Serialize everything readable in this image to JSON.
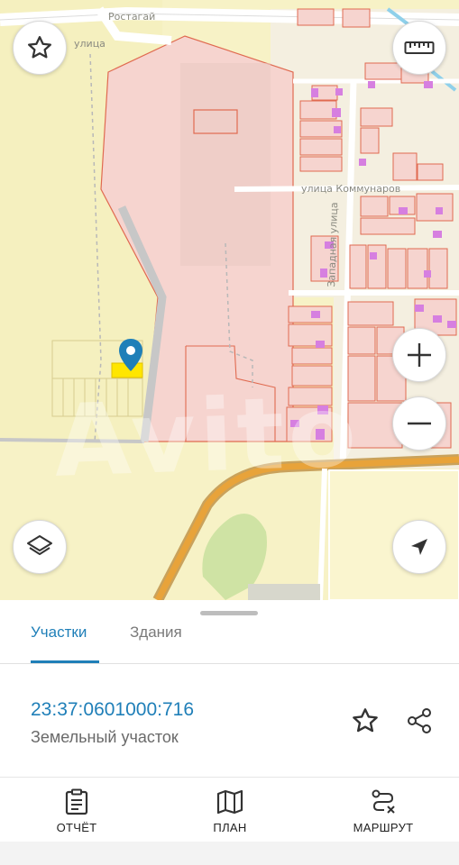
{
  "map": {
    "streets": {
      "top": "Ростагай",
      "left_street": "улица",
      "kommunarov": "улица Коммунаров",
      "zapadnaya": "Западная улица"
    },
    "watermark": "Avito"
  },
  "map_controls": {
    "favorite_icon": "star-outline-icon",
    "ruler_icon": "ruler-icon",
    "zoom_in_icon": "plus-icon",
    "zoom_out_icon": "minus-icon",
    "layers_icon": "layers-icon",
    "location_icon": "navigation-arrow-icon"
  },
  "sheet": {
    "tabs": [
      {
        "label": "Участки",
        "active": true
      },
      {
        "label": "Здания",
        "active": false
      }
    ],
    "parcel": {
      "cadastral_number": "23:37:0601000:716",
      "type": "Земельный участок"
    },
    "actions": [
      {
        "label": "ОТЧЁТ",
        "icon": "clipboard-icon"
      },
      {
        "label": "ПЛАН",
        "icon": "map-icon"
      },
      {
        "label": "МАРШРУТ",
        "icon": "route-icon"
      }
    ]
  },
  "colors": {
    "accent": "#1f7fb8",
    "parcel_fill": "#f6d4cf",
    "parcel_border": "#e06a50",
    "building": "#d67fe0",
    "field": "#f7f2c6",
    "road_orange": "#e8a33a",
    "highlight": "#ffe600"
  }
}
